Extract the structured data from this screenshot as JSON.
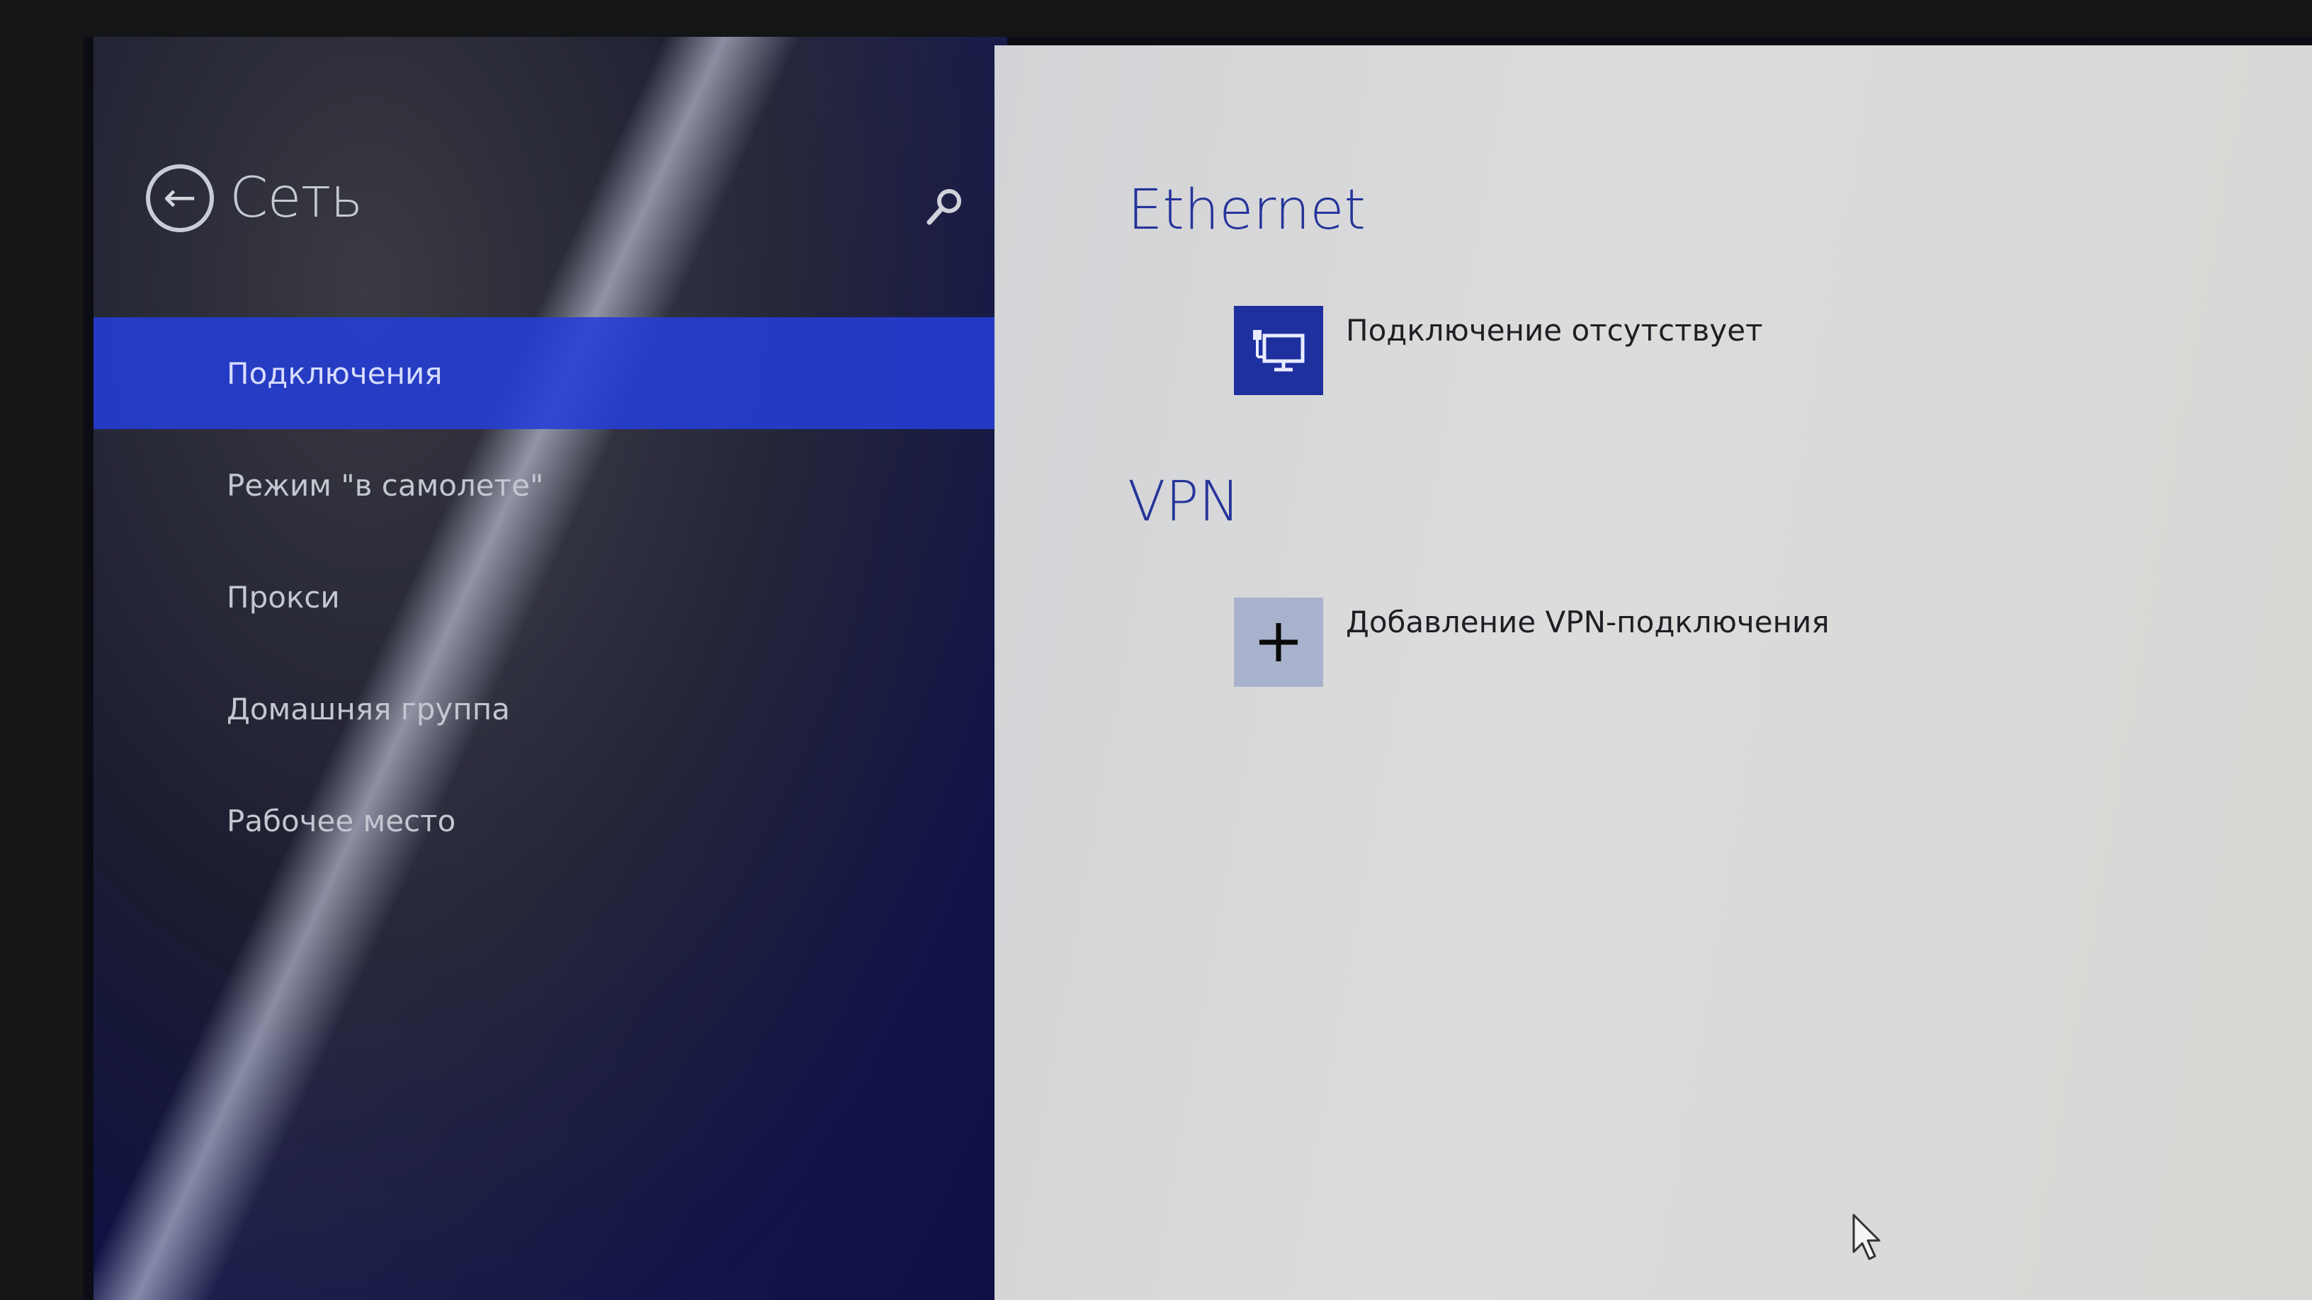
{
  "nav": {
    "title": "Сеть",
    "back_icon": "back-arrow-icon",
    "search_icon": "search-icon",
    "items": [
      {
        "label": "Подключения",
        "active": true
      },
      {
        "label": "Режим \"в самолете\"",
        "active": false
      },
      {
        "label": "Прокси",
        "active": false
      },
      {
        "label": "Домашняя группа",
        "active": false
      },
      {
        "label": "Рабочее место",
        "active": false
      }
    ]
  },
  "content": {
    "ethernet": {
      "title": "Ethernet",
      "status": "Подключение отсутствует",
      "icon": "ethernet-icon"
    },
    "vpn": {
      "title": "VPN",
      "add_label": "Добавление VPN-подключения",
      "icon": "plus-icon"
    }
  },
  "colors": {
    "accent": "#2437c8",
    "heading": "#26349a",
    "tile": "#1e2f9e"
  }
}
